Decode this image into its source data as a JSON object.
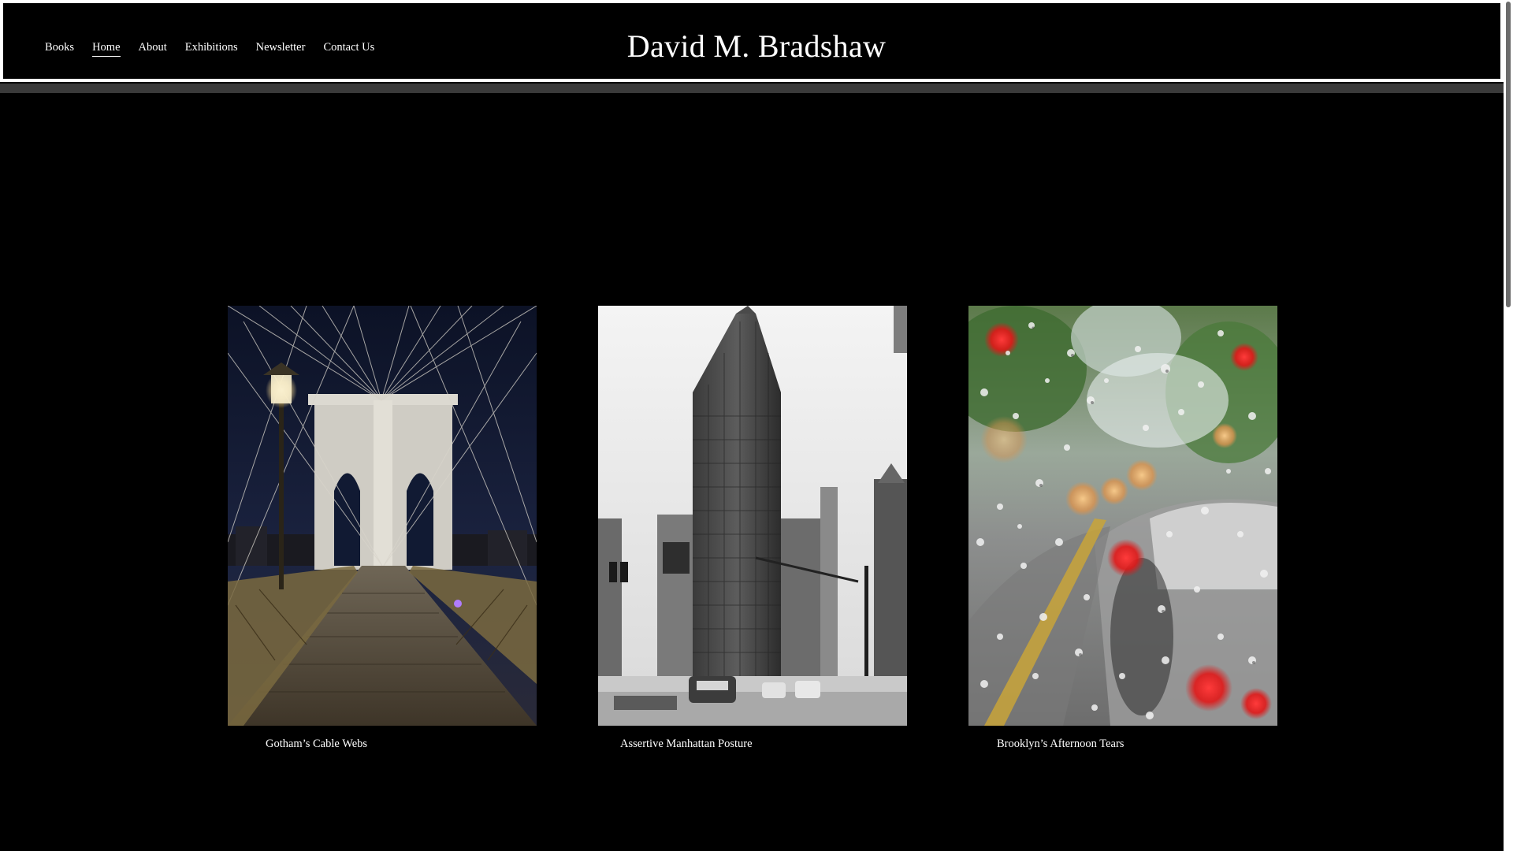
{
  "site": {
    "title": "David M. Bradshaw"
  },
  "nav": {
    "items": [
      {
        "label": "Books",
        "active": false
      },
      {
        "label": "Home",
        "active": true
      },
      {
        "label": "About",
        "active": false
      },
      {
        "label": "Exhibitions",
        "active": false
      },
      {
        "label": "Newsletter",
        "active": false
      },
      {
        "label": "Contact Us",
        "active": false
      }
    ]
  },
  "gallery": {
    "items": [
      {
        "caption": "Gotham’s Cable Webs",
        "image": "brooklyn-bridge-night-photo"
      },
      {
        "caption": "Assertive Manhattan Posture",
        "image": "flatiron-building-bw-photo"
      },
      {
        "caption": "Brooklyn’s Afternoon Tears",
        "image": "rainy-windshield-bokeh-photo"
      }
    ]
  },
  "colors": {
    "background": "#000000",
    "text": "#ffffff",
    "header_border": "#ffffff",
    "header_strip": "#3a3a3a"
  }
}
